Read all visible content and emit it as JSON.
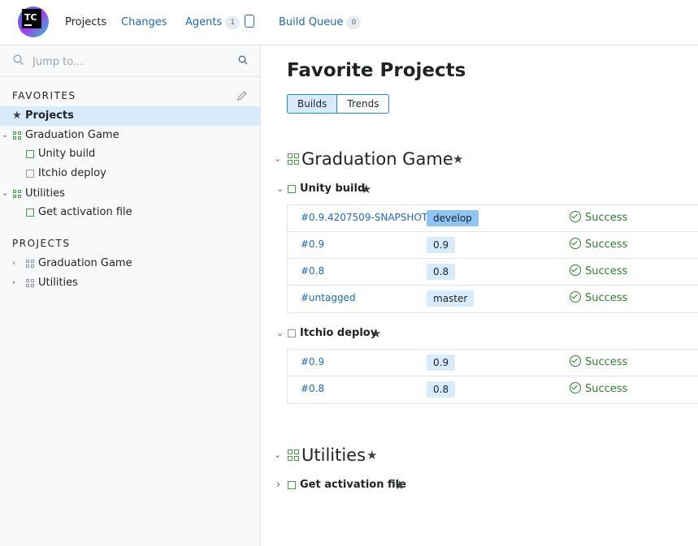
{
  "header": {
    "logo_text": "TC",
    "nav": {
      "projects": "Projects",
      "changes": "Changes",
      "agents": "Agents",
      "agents_count": "1",
      "build_queue": "Build Queue",
      "queue_count": "0"
    }
  },
  "sidebar": {
    "search_placeholder": "Jump to...",
    "favorites_title": "FAVORITES",
    "favorites": [
      {
        "label": "Projects",
        "icon": "star-icon",
        "selected": true
      },
      {
        "label": "Graduation Game",
        "icon": "project-icon"
      },
      {
        "label": "Unity build",
        "icon": "build-config-icon"
      },
      {
        "label": "Itchio deploy",
        "icon": "build-config-icon"
      },
      {
        "label": "Utilities",
        "icon": "project-icon"
      },
      {
        "label": "Get activation file",
        "icon": "build-config-icon"
      }
    ],
    "projects_title": "PROJECTS",
    "projects": [
      {
        "label": "Graduation Game"
      },
      {
        "label": "Utilities"
      }
    ]
  },
  "main": {
    "title": "Favorite Projects",
    "tabs": [
      "Builds",
      "Trends"
    ],
    "projects": [
      {
        "name": "Graduation Game",
        "build_configs": [
          {
            "name": "Unity build",
            "builds": [
              {
                "number": "#0.9.4207509-SNAPSHOT",
                "branch": "develop",
                "status": "Success"
              },
              {
                "number": "#0.9",
                "branch": "0.9",
                "status": "Success"
              },
              {
                "number": "#0.8",
                "branch": "0.8",
                "status": "Success"
              },
              {
                "number": "#untagged",
                "branch": "master",
                "status": "Success"
              }
            ]
          },
          {
            "name": "Itchio deploy",
            "builds": [
              {
                "number": "#0.9",
                "branch": "0.9",
                "status": "Success"
              },
              {
                "number": "#0.8",
                "branch": "0.8",
                "status": "Success"
              }
            ]
          }
        ]
      },
      {
        "name": "Utilities",
        "build_configs": [
          {
            "name": "Get activation file"
          }
        ]
      }
    ]
  },
  "colors": {
    "accent": "#1e69b9",
    "selected_bg": "#d7ebfb",
    "success": "#2e7d32",
    "project_icon": "#43a047",
    "default_branch": "#8ec5f4"
  }
}
